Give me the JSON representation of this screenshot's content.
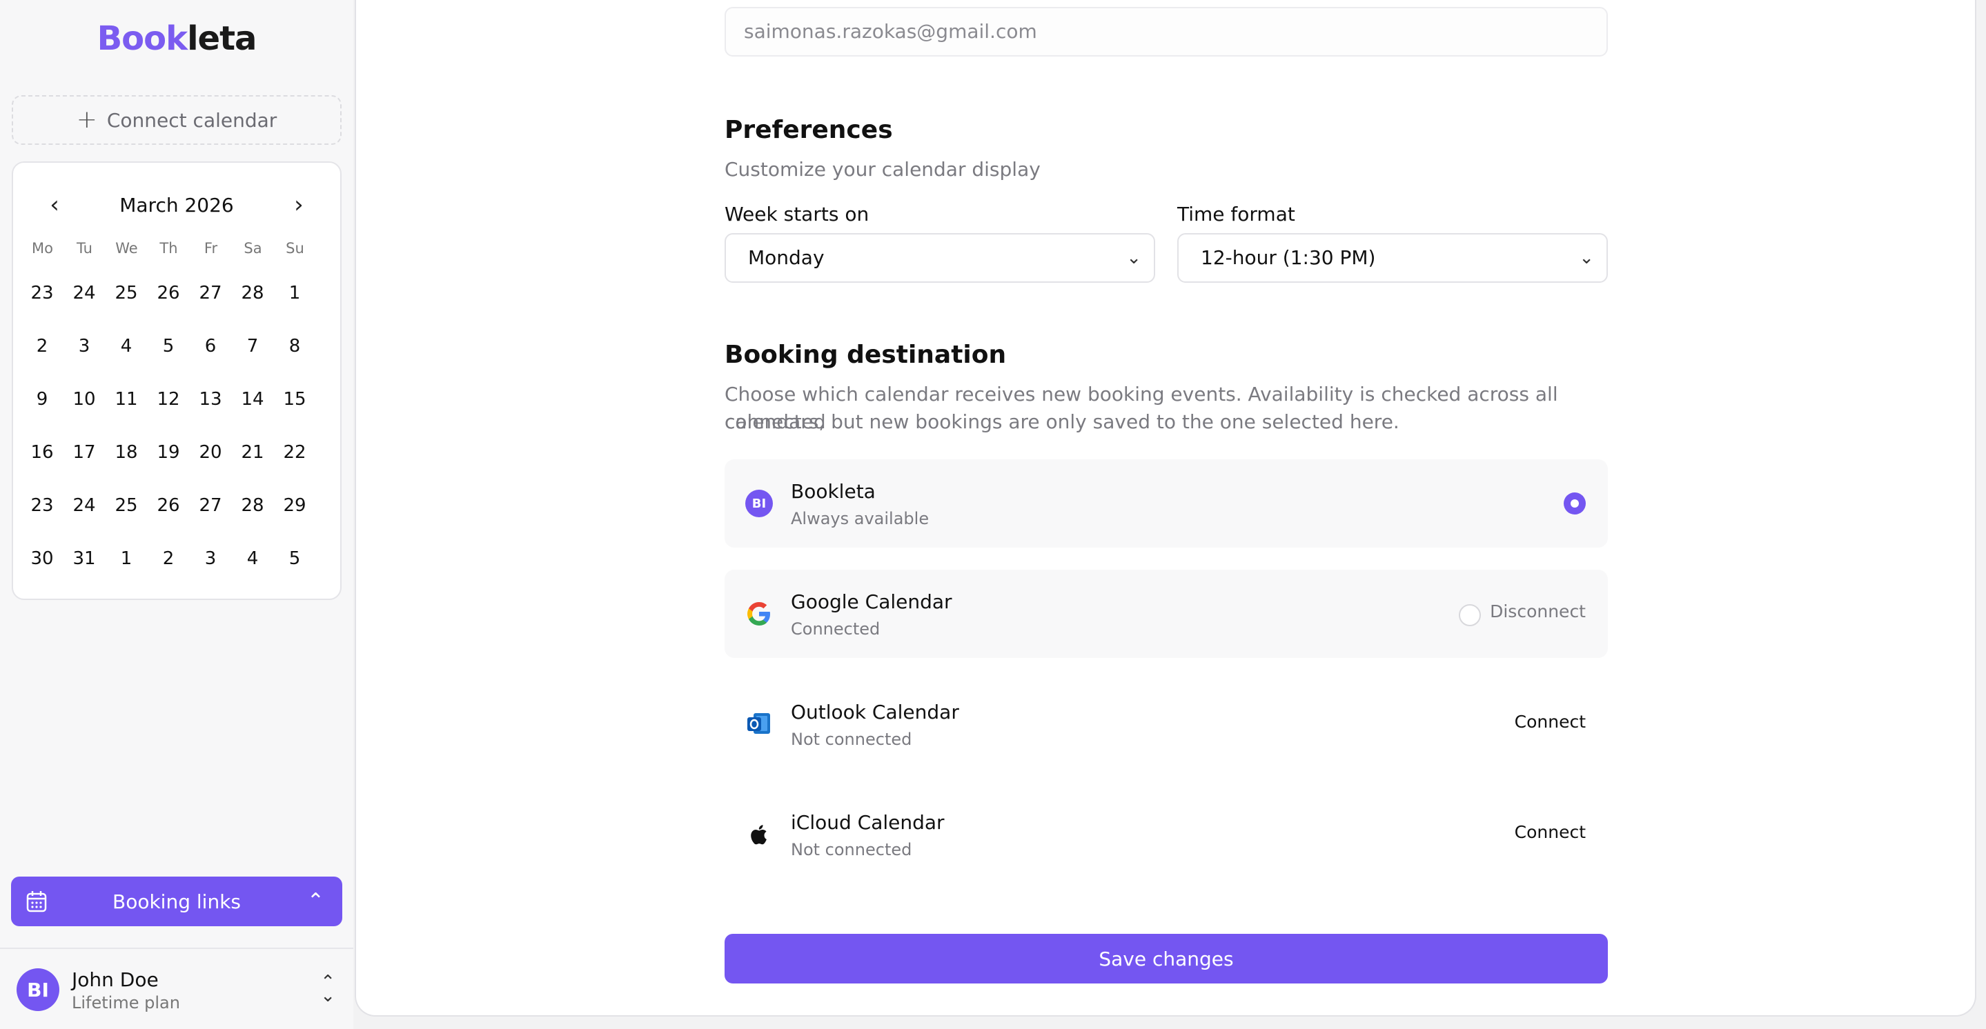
{
  "sidebar": {
    "logo_brand": "Book",
    "logo_rest": "leta",
    "connect_calendar_label": "Connect calendar",
    "calendar": {
      "month_title": "March 2026",
      "weekdays": [
        "Mo",
        "Tu",
        "We",
        "Th",
        "Fr",
        "Sa",
        "Su"
      ],
      "days": [
        "23",
        "24",
        "25",
        "26",
        "27",
        "28",
        "1",
        "2",
        "3",
        "4",
        "5",
        "6",
        "7",
        "8",
        "9",
        "10",
        "11",
        "12",
        "13",
        "14",
        "15",
        "16",
        "17",
        "18",
        "19",
        "20",
        "21",
        "22",
        "23",
        "24",
        "25",
        "26",
        "27",
        "28",
        "29",
        "30",
        "31",
        "1",
        "2",
        "3",
        "4",
        "5"
      ],
      "selected_day": "17"
    },
    "booking_links_label": "Booking links",
    "user": {
      "initials": "BI",
      "name": "John Doe",
      "plan": "Lifetime plan"
    }
  },
  "main": {
    "email_value": "saimonas.razokas@gmail.com",
    "preferences": {
      "title": "Preferences",
      "subtitle": "Customize your calendar display",
      "week_starts_label": "Week starts on",
      "week_starts_value": "Monday",
      "time_format_label": "Time format",
      "time_format_value": "12-hour (1:30 PM)"
    },
    "booking_destination": {
      "title": "Booking destination",
      "description_line1": "Choose which calendar receives new booking events. Availability is checked across all connected",
      "description_line2": "calendars, but new bookings are only saved to the one selected here.",
      "options": [
        {
          "title": "Bookleta",
          "subtitle": "Always available",
          "avatar": "BI",
          "selected": true,
          "action": ""
        },
        {
          "title": "Google Calendar",
          "subtitle": "Connected",
          "selected": false,
          "action": "Disconnect"
        },
        {
          "title": "Outlook Calendar",
          "subtitle": "Not connected",
          "selected": false,
          "action": "Connect"
        },
        {
          "title": "iCloud Calendar",
          "subtitle": "Not connected",
          "selected": false,
          "action": "Connect"
        }
      ]
    },
    "save_label": "Save changes"
  },
  "colors": {
    "accent": "#7456f1",
    "logo_accent": "#7b5cf0"
  }
}
